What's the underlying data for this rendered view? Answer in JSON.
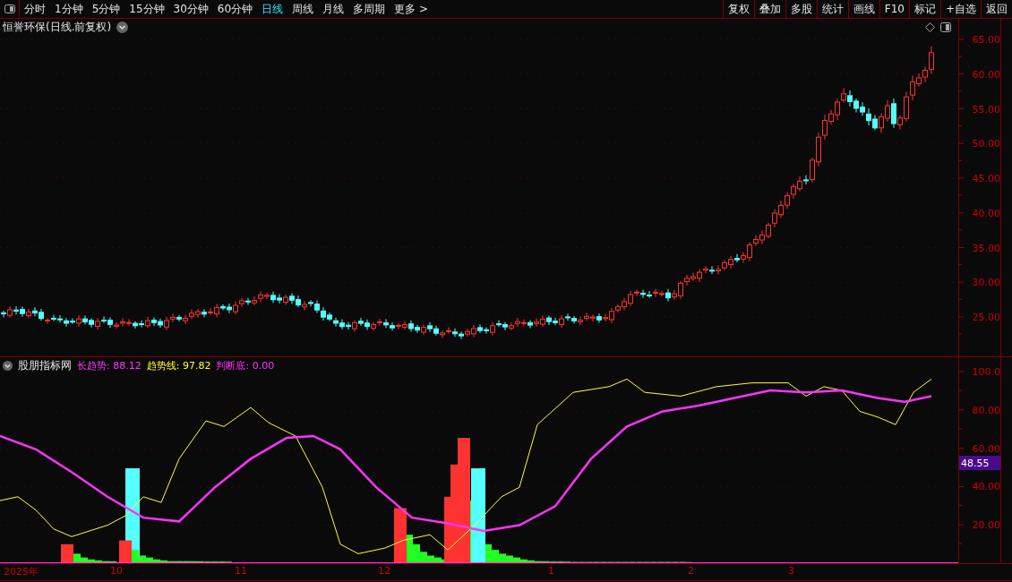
{
  "toolbar": {
    "periods": [
      {
        "label": "分时",
        "selected": false
      },
      {
        "label": "1分钟",
        "selected": false
      },
      {
        "label": "5分钟",
        "selected": false
      },
      {
        "label": "15分钟",
        "selected": false
      },
      {
        "label": "30分钟",
        "selected": false
      },
      {
        "label": "60分钟",
        "selected": false
      },
      {
        "label": "日线",
        "selected": true
      },
      {
        "label": "周线",
        "selected": false
      },
      {
        "label": "月线",
        "selected": false
      },
      {
        "label": "多周期",
        "selected": false
      }
    ],
    "more": "更多 >",
    "actions": [
      "复权",
      "叠加",
      "多股",
      "统计",
      "画线",
      "F10",
      "标记",
      "+自选",
      "返回"
    ]
  },
  "price_chart": {
    "title": "恒誉环保(日线.前复权)",
    "yticks": [
      "65.00",
      "60.00",
      "55.00",
      "50.00",
      "45.00",
      "40.00",
      "35.00",
      "30.00",
      "25.00"
    ]
  },
  "indicator": {
    "name": "股朋指标网",
    "metrics": [
      {
        "label": "长趋势:",
        "value": "88.12",
        "color": "#ff33ff"
      },
      {
        "label": "趋势线:",
        "value": "97.82",
        "color": "#ffff33"
      },
      {
        "label": "判断底:",
        "value": "0.00",
        "color": "#ff33ff"
      }
    ],
    "yticks": [
      "100.0",
      "80.00",
      "60.00",
      "40.00",
      "20.00"
    ],
    "cursor_value": "48.55"
  },
  "date_axis": [
    "2025年",
    "10",
    "11",
    "12",
    "1",
    "2",
    "3"
  ]
}
